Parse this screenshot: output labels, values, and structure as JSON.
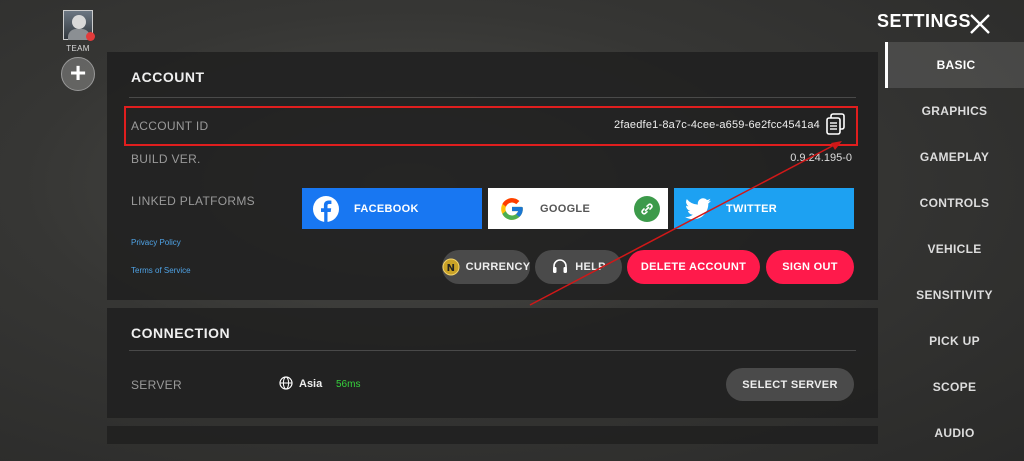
{
  "team": {
    "label": "TEAM",
    "add_symbol": "+"
  },
  "settings": {
    "title": "SETTINGS"
  },
  "nav": [
    {
      "label": "BASIC",
      "active": true
    },
    {
      "label": "GRAPHICS"
    },
    {
      "label": "GAMEPLAY"
    },
    {
      "label": "CONTROLS"
    },
    {
      "label": "VEHICLE"
    },
    {
      "label": "SENSITIVITY"
    },
    {
      "label": "PICK UP"
    },
    {
      "label": "SCOPE"
    },
    {
      "label": "AUDIO"
    }
  ],
  "account": {
    "title": "ACCOUNT",
    "id_label": "ACCOUNT ID",
    "id_value": "2faedfe1-8a7c-4cee-a659-6e2fcc4541a4",
    "build_label": "BUILD VER.",
    "build_value": "0.9.24.195-0",
    "linked_label": "LINKED PLATFORMS",
    "platforms": [
      {
        "label": "FACEBOOK",
        "icon": "facebook-icon",
        "color": "#1877f2"
      },
      {
        "label": "GOOGLE",
        "icon": "google-icon",
        "color": "#ffffff",
        "linked": true
      },
      {
        "label": "TWITTER",
        "icon": "twitter-icon",
        "color": "#1da1f2"
      }
    ],
    "privacy_policy": "Privacy Policy",
    "terms": "Terms of Service",
    "actions": {
      "currency": "CURRENCY",
      "help": "HELP",
      "delete_account": "DELETE ACCOUNT",
      "sign_out": "SIGN OUT"
    }
  },
  "connection": {
    "title": "CONNECTION",
    "server_label": "SERVER",
    "region": "Asia",
    "ping": "56ms",
    "select_server": "SELECT SERVER"
  },
  "colors": {
    "accent_red": "#ff1a4b",
    "highlight_red": "#e01e1e",
    "ping_green": "#36d13c",
    "facebook_blue": "#1877f2",
    "twitter_blue": "#1da1f2"
  }
}
